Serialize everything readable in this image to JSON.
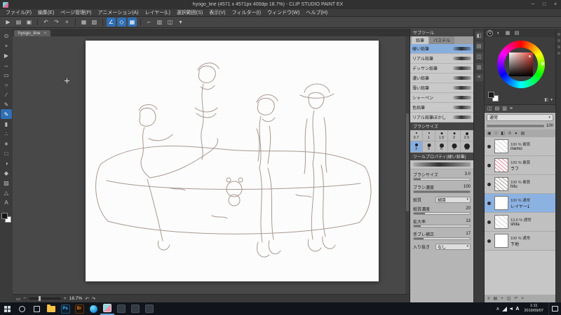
{
  "colors": {
    "accent": "#2f6fb4",
    "selection": "#88aedd",
    "canvas_bg": "#484848",
    "linework": "#a08e85"
  },
  "window": {
    "title": "hyogo_line (4571 x 4571px 400dpi 18.7%) - CLIP STUDIO PAINT EX",
    "minimize": "─",
    "maximize": "□",
    "close": "×"
  },
  "menu": {
    "items": [
      "ファイル(F)",
      "編集(E)",
      "ページ管理(P)",
      "アニメーション(A)",
      "レイヤー(L)",
      "選択範囲(S)",
      "表示(V)",
      "フィルター(I)",
      "ウィンドウ(W)",
      "ヘルプ(H)"
    ]
  },
  "toolbar": {
    "icons": [
      {
        "name": "pointer-icon",
        "glyph": "▶"
      },
      {
        "name": "new-canvas-icon",
        "glyph": "▤"
      },
      {
        "name": "save-icon",
        "glyph": "▣"
      },
      {
        "name": "undo-icon",
        "glyph": "↶"
      },
      {
        "name": "redo-icon",
        "glyph": "↷"
      },
      {
        "name": "delete-icon",
        "glyph": "×"
      },
      {
        "name": "deselect-icon",
        "glyph": "▦"
      },
      {
        "name": "crop-icon",
        "glyph": "▧"
      },
      {
        "name": "snap-ruler-icon",
        "glyph": "∠",
        "active": true
      },
      {
        "name": "snap-special-ruler-icon",
        "glyph": "◇",
        "active": true
      },
      {
        "name": "snap-grid-icon",
        "glyph": "▦",
        "active": true
      },
      {
        "name": "ruler-icon",
        "glyph": "⌐"
      },
      {
        "name": "grid-icon",
        "glyph": "▥"
      },
      {
        "name": "material-icon",
        "glyph": "◫"
      },
      {
        "name": "workspace-icon",
        "glyph": "▾"
      }
    ]
  },
  "tools": {
    "selected": "tool-pencil",
    "items": [
      {
        "name": "tool-zoom",
        "glyph": "⊙"
      },
      {
        "name": "tool-move",
        "glyph": "+"
      },
      {
        "name": "tool-operation",
        "glyph": "▶"
      },
      {
        "name": "tool-layer-move",
        "glyph": "↔"
      },
      {
        "name": "tool-selection",
        "glyph": "▭"
      },
      {
        "name": "tool-auto-select",
        "glyph": "○"
      },
      {
        "name": "tool-eyedropper",
        "glyph": "∕"
      },
      {
        "name": "tool-pen",
        "glyph": "✎"
      },
      {
        "name": "tool-pencil",
        "glyph": "✎"
      },
      {
        "name": "tool-brush",
        "glyph": "▮"
      },
      {
        "name": "tool-airbrush",
        "glyph": "∴"
      },
      {
        "name": "tool-decoration",
        "glyph": "∗"
      },
      {
        "name": "tool-eraser",
        "glyph": "□"
      },
      {
        "name": "tool-blend",
        "glyph": "◑"
      },
      {
        "name": "tool-fill",
        "glyph": "◆"
      },
      {
        "name": "tool-gradient",
        "glyph": "▨"
      },
      {
        "name": "tool-figure",
        "glyph": "△"
      },
      {
        "name": "tool-text",
        "glyph": "A"
      }
    ]
  },
  "canvas": {
    "tab_label": "hyogo_line",
    "tab_close": "×",
    "zoom_display": "18.7%"
  },
  "subtool": {
    "header": "サブツール",
    "tabs": [
      "鉛筆",
      "パステル"
    ],
    "selected": "硬い鉛筆",
    "items": [
      "硬い鉛筆",
      "リアル鉛筆",
      "デッサン鉛筆",
      "濃い鉛筆",
      "薄い鉛筆",
      "シャーペン",
      "色鉛筆",
      "リアル鉛筆ぼかし"
    ]
  },
  "brush_size": {
    "header": "ブラシサイズ",
    "selected": "3",
    "sizes": [
      "0.7",
      "1",
      "1.5",
      "2",
      "2.5",
      "3",
      "5",
      "6",
      "8",
      "10"
    ]
  },
  "tool_property": {
    "header": "ツールプロパティ(硬い鉛筆)",
    "tool_name": "硬い鉛筆",
    "props": [
      {
        "label": "ブラシサイズ",
        "value": "3.0",
        "type": "slider",
        "fill": 12
      },
      {
        "label": "ブラシ濃度",
        "value": "100",
        "type": "slider",
        "fill": 100
      },
      {
        "label": "紙質",
        "value": "細目",
        "type": "dropdown"
      },
      {
        "label": "紙質濃度",
        "value": "20",
        "type": "slider",
        "fill": 20
      },
      {
        "label": "拡大率",
        "value": "13",
        "type": "slider",
        "fill": 13
      },
      {
        "label": "手ブレ補正",
        "value": "17",
        "type": "slider",
        "fill": 17
      },
      {
        "label": "入り抜き",
        "value": "なし",
        "type": "dropdown"
      }
    ]
  },
  "color": {
    "quick_access": "Q",
    "main": "#1a1a1a",
    "sub": "#ffffff"
  },
  "layers": {
    "blend_mode": "通常",
    "opacity_label": "100",
    "opacity_fill": 100,
    "items": [
      {
        "visible": true,
        "mode": "100 % 乗算",
        "name": "memo",
        "thumb": "light"
      },
      {
        "visible": true,
        "mode": "100 % 乗算",
        "name": "ラフ",
        "thumb": "red"
      },
      {
        "visible": true,
        "mode": "100 % 乗算",
        "name": "hitu",
        "thumb": "sketch"
      },
      {
        "visible": true,
        "mode": "100 % 通常",
        "name": "レイヤー1",
        "thumb": "white",
        "selected": true
      },
      {
        "visible": true,
        "mode": "13.5 % 通常",
        "name": "shita",
        "thumb": "light"
      },
      {
        "visible": true,
        "mode": "100 % 通常",
        "name": "下地",
        "thumb": "white"
      }
    ]
  },
  "icon_strips": {
    "palette_tabs": [
      "◐",
      "▦",
      "▤"
    ],
    "col_strip": [
      "◧",
      "▤",
      "◫",
      "▥",
      "≡"
    ],
    "mid_icons": [
      "◫",
      "▤",
      "▥",
      "≡"
    ],
    "layer_toolbar": [
      "▣",
      "□",
      "◧",
      "A",
      "●",
      "▤"
    ],
    "layer_footer": [
      "≡",
      "▤",
      "+",
      "◫",
      "↶",
      "×"
    ],
    "color_misc": [
      "◧",
      "▾"
    ],
    "canvas_status": {
      "fit": "▭",
      "minus": "−",
      "plus": "+",
      "undo": "↶",
      "redo": "↷"
    }
  },
  "taskbar": {
    "apps": [
      {
        "name": "file-explorer",
        "label": ""
      },
      {
        "name": "photoshop",
        "label": "Ps"
      },
      {
        "name": "bridge",
        "label": "Br"
      },
      {
        "name": "edge",
        "label": ""
      },
      {
        "name": "clip-studio",
        "label": "",
        "open": true
      },
      {
        "name": "app-6",
        "label": ""
      },
      {
        "name": "app-7",
        "label": ""
      },
      {
        "name": "app-8",
        "label": ""
      }
    ],
    "tray": {
      "chevron": "∧",
      "ime": "A",
      "time": "1:11",
      "date": "2019/09/07"
    }
  }
}
